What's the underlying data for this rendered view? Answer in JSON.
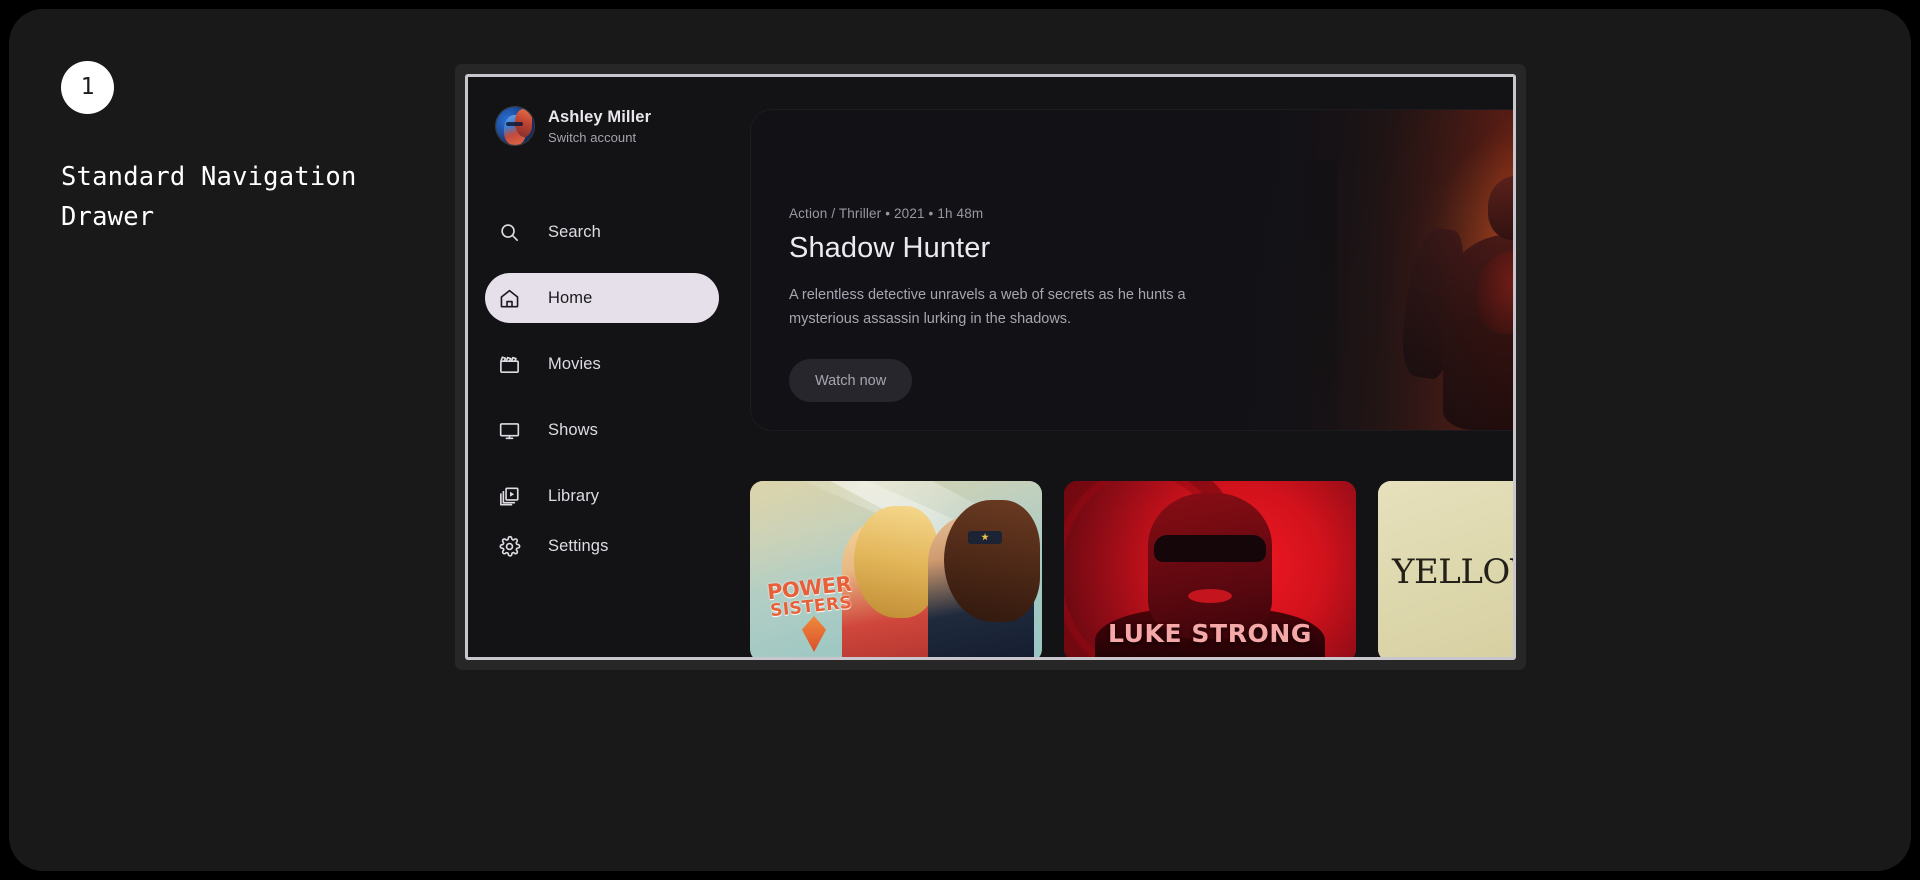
{
  "annotation": {
    "step_number": "1",
    "title": "Standard Navigation\nDrawer"
  },
  "drawer": {
    "account": {
      "name": "Ashley Miller",
      "switch_label": "Switch account",
      "avatar_alt": "user-avatar"
    },
    "items": [
      {
        "label": "Search",
        "icon": "search-icon",
        "active": false
      },
      {
        "label": "Home",
        "icon": "home-icon",
        "active": true
      },
      {
        "label": "Movies",
        "icon": "movie-icon",
        "active": false
      },
      {
        "label": "Shows",
        "icon": "tv-icon",
        "active": false
      },
      {
        "label": "Library",
        "icon": "library-icon",
        "active": false
      }
    ],
    "settings": {
      "label": "Settings",
      "icon": "gear-icon"
    }
  },
  "hero": {
    "meta": "Action / Thriller • 2021 • 1h 48m",
    "title": "Shadow Hunter",
    "description": "A relentless detective unravels a web of secrets as he hunts a mysterious assassin lurking in the shadows.",
    "watch_label": "Watch now"
  },
  "posters": [
    {
      "title_line1": "POWER",
      "title_line2": "SISTERS"
    },
    {
      "title": "LUKE STRONG"
    },
    {
      "title": "YELLOW"
    }
  ],
  "colors": {
    "page_background": "#000000",
    "panel_background": "#191919",
    "screen_background": "#131316",
    "bezel": "#c9c6cd",
    "active_pill": "#e6e0ea",
    "text_primary": "#eceaf0",
    "text_secondary": "#a9a5b0",
    "accent_orange": "#e27a28",
    "accent_red": "#d2121c"
  }
}
